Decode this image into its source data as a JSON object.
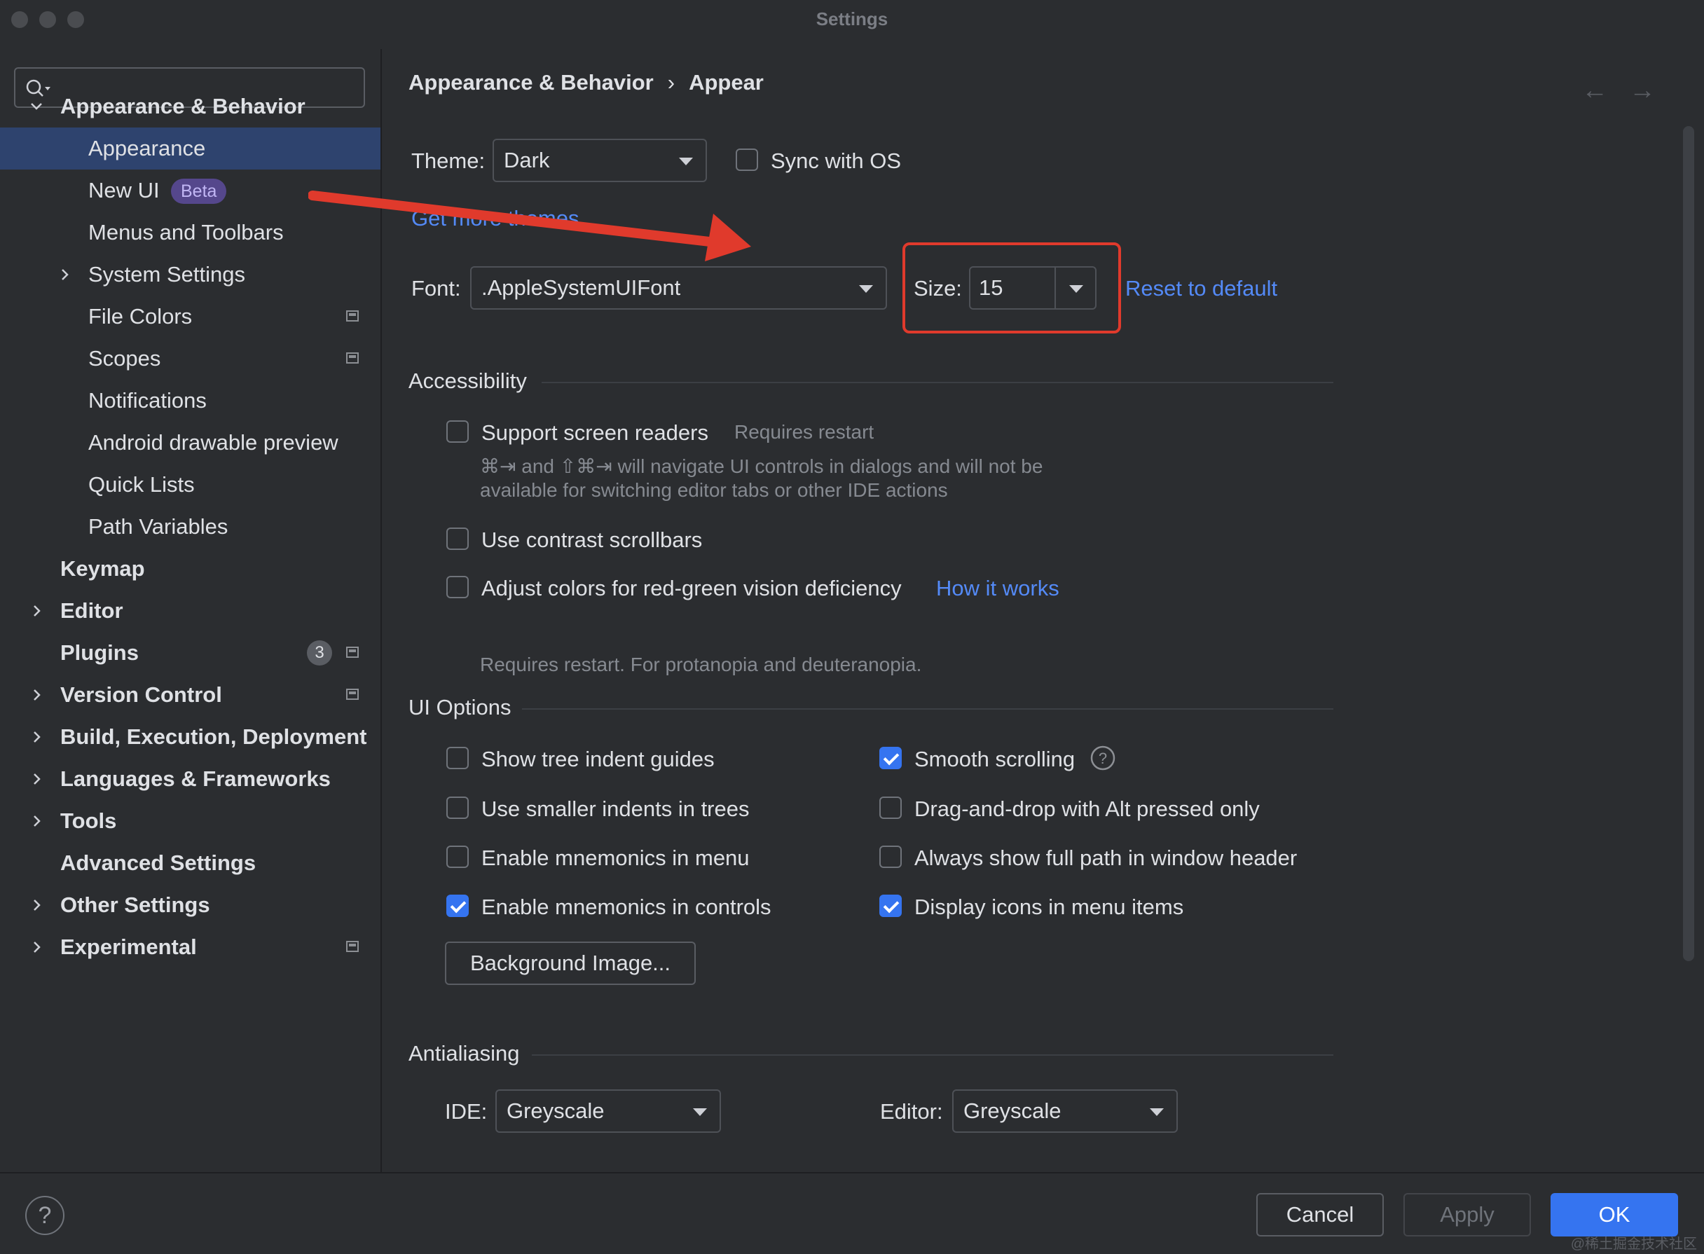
{
  "window": {
    "title": "Settings"
  },
  "sidebar": {
    "search_placeholder": "",
    "items": [
      {
        "label": "Appearance & Behavior"
      },
      {
        "label": "Appearance"
      },
      {
        "label": "New UI",
        "badge": "Beta"
      },
      {
        "label": "Menus and Toolbars"
      },
      {
        "label": "System Settings"
      },
      {
        "label": "File Colors"
      },
      {
        "label": "Scopes"
      },
      {
        "label": "Notifications"
      },
      {
        "label": "Android drawable preview"
      },
      {
        "label": "Quick Lists"
      },
      {
        "label": "Path Variables"
      },
      {
        "label": "Keymap"
      },
      {
        "label": "Editor"
      },
      {
        "label": "Plugins",
        "count": "3"
      },
      {
        "label": "Version Control"
      },
      {
        "label": "Build, Execution, Deployment"
      },
      {
        "label": "Languages & Frameworks"
      },
      {
        "label": "Tools"
      },
      {
        "label": "Advanced Settings"
      },
      {
        "label": "Other Settings"
      },
      {
        "label": "Experimental"
      }
    ]
  },
  "header": {
    "breadcrumb_parent": "Appearance & Behavior",
    "breadcrumb_sep": "›",
    "breadcrumb_current": "Appear"
  },
  "theme": {
    "label": "Theme:",
    "value": "Dark",
    "sync_label": "Sync with OS",
    "sync_checked": false,
    "get_more": "Get more themes"
  },
  "font": {
    "label": "Font:",
    "value": ".AppleSystemUIFont",
    "size_label": "Size:",
    "size_value": "15",
    "reset": "Reset to default"
  },
  "accessibility": {
    "title": "Accessibility",
    "screen_readers": "Support screen readers",
    "requires_restart": "Requires restart",
    "screen_readers_hint_1": "⌘⇥ and ⇧⌘⇥ will navigate UI controls in dialogs and will not be",
    "screen_readers_hint_2": "available for switching editor tabs or other IDE actions",
    "contrast_scrollbars": "Use contrast scrollbars",
    "color_deficiency": "Adjust colors for red-green vision deficiency",
    "how_it_works": "How it works",
    "color_hint": "Requires restart. For protanopia and deuteranopia."
  },
  "ui_options": {
    "title": "UI Options",
    "tree_indent": "Show tree indent guides",
    "smaller_indents": "Use smaller indents in trees",
    "mnemonics_menu": "Enable mnemonics in menu",
    "mnemonics_controls": "Enable mnemonics in controls",
    "smooth_scrolling": "Smooth scrolling",
    "drag_drop": "Drag-and-drop with Alt pressed only",
    "full_path": "Always show full path in window header",
    "icons_menu": "Display icons in menu items",
    "background_image": "Background Image..."
  },
  "antialiasing": {
    "title": "Antialiasing",
    "ide_label": "IDE:",
    "ide_value": "Greyscale",
    "editor_label": "Editor:",
    "editor_value": "Greyscale"
  },
  "footer": {
    "help": "?",
    "cancel": "Cancel",
    "apply": "Apply",
    "ok": "OK"
  },
  "watermark": "@稀土掘金技术社区",
  "colors": {
    "accent": "#3574f0",
    "link": "#548af7",
    "selection": "#2e436e",
    "annotation_red": "#e03a2c"
  }
}
